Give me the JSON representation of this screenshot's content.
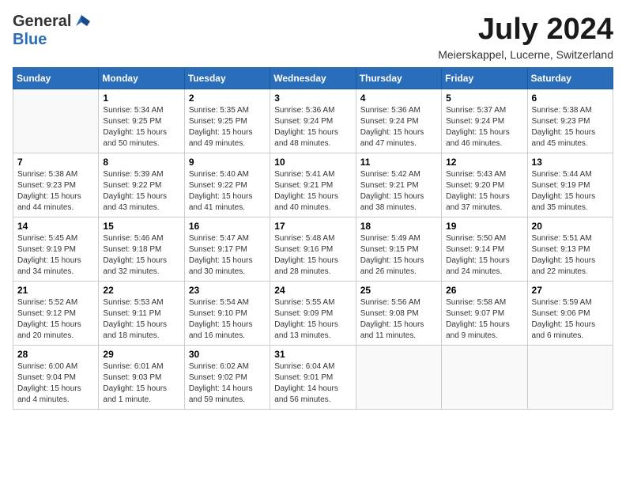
{
  "header": {
    "logo_general": "General",
    "logo_blue": "Blue",
    "month_title": "July 2024",
    "location": "Meierskappel, Lucerne, Switzerland"
  },
  "weekdays": [
    "Sunday",
    "Monday",
    "Tuesday",
    "Wednesday",
    "Thursday",
    "Friday",
    "Saturday"
  ],
  "weeks": [
    [
      {
        "day": "",
        "sunrise": "",
        "sunset": "",
        "daylight": ""
      },
      {
        "day": "1",
        "sunrise": "Sunrise: 5:34 AM",
        "sunset": "Sunset: 9:25 PM",
        "daylight": "Daylight: 15 hours and 50 minutes."
      },
      {
        "day": "2",
        "sunrise": "Sunrise: 5:35 AM",
        "sunset": "Sunset: 9:25 PM",
        "daylight": "Daylight: 15 hours and 49 minutes."
      },
      {
        "day": "3",
        "sunrise": "Sunrise: 5:36 AM",
        "sunset": "Sunset: 9:24 PM",
        "daylight": "Daylight: 15 hours and 48 minutes."
      },
      {
        "day": "4",
        "sunrise": "Sunrise: 5:36 AM",
        "sunset": "Sunset: 9:24 PM",
        "daylight": "Daylight: 15 hours and 47 minutes."
      },
      {
        "day": "5",
        "sunrise": "Sunrise: 5:37 AM",
        "sunset": "Sunset: 9:24 PM",
        "daylight": "Daylight: 15 hours and 46 minutes."
      },
      {
        "day": "6",
        "sunrise": "Sunrise: 5:38 AM",
        "sunset": "Sunset: 9:23 PM",
        "daylight": "Daylight: 15 hours and 45 minutes."
      }
    ],
    [
      {
        "day": "7",
        "sunrise": "Sunrise: 5:38 AM",
        "sunset": "Sunset: 9:23 PM",
        "daylight": "Daylight: 15 hours and 44 minutes."
      },
      {
        "day": "8",
        "sunrise": "Sunrise: 5:39 AM",
        "sunset": "Sunset: 9:22 PM",
        "daylight": "Daylight: 15 hours and 43 minutes."
      },
      {
        "day": "9",
        "sunrise": "Sunrise: 5:40 AM",
        "sunset": "Sunset: 9:22 PM",
        "daylight": "Daylight: 15 hours and 41 minutes."
      },
      {
        "day": "10",
        "sunrise": "Sunrise: 5:41 AM",
        "sunset": "Sunset: 9:21 PM",
        "daylight": "Daylight: 15 hours and 40 minutes."
      },
      {
        "day": "11",
        "sunrise": "Sunrise: 5:42 AM",
        "sunset": "Sunset: 9:21 PM",
        "daylight": "Daylight: 15 hours and 38 minutes."
      },
      {
        "day": "12",
        "sunrise": "Sunrise: 5:43 AM",
        "sunset": "Sunset: 9:20 PM",
        "daylight": "Daylight: 15 hours and 37 minutes."
      },
      {
        "day": "13",
        "sunrise": "Sunrise: 5:44 AM",
        "sunset": "Sunset: 9:19 PM",
        "daylight": "Daylight: 15 hours and 35 minutes."
      }
    ],
    [
      {
        "day": "14",
        "sunrise": "Sunrise: 5:45 AM",
        "sunset": "Sunset: 9:19 PM",
        "daylight": "Daylight: 15 hours and 34 minutes."
      },
      {
        "day": "15",
        "sunrise": "Sunrise: 5:46 AM",
        "sunset": "Sunset: 9:18 PM",
        "daylight": "Daylight: 15 hours and 32 minutes."
      },
      {
        "day": "16",
        "sunrise": "Sunrise: 5:47 AM",
        "sunset": "Sunset: 9:17 PM",
        "daylight": "Daylight: 15 hours and 30 minutes."
      },
      {
        "day": "17",
        "sunrise": "Sunrise: 5:48 AM",
        "sunset": "Sunset: 9:16 PM",
        "daylight": "Daylight: 15 hours and 28 minutes."
      },
      {
        "day": "18",
        "sunrise": "Sunrise: 5:49 AM",
        "sunset": "Sunset: 9:15 PM",
        "daylight": "Daylight: 15 hours and 26 minutes."
      },
      {
        "day": "19",
        "sunrise": "Sunrise: 5:50 AM",
        "sunset": "Sunset: 9:14 PM",
        "daylight": "Daylight: 15 hours and 24 minutes."
      },
      {
        "day": "20",
        "sunrise": "Sunrise: 5:51 AM",
        "sunset": "Sunset: 9:13 PM",
        "daylight": "Daylight: 15 hours and 22 minutes."
      }
    ],
    [
      {
        "day": "21",
        "sunrise": "Sunrise: 5:52 AM",
        "sunset": "Sunset: 9:12 PM",
        "daylight": "Daylight: 15 hours and 20 minutes."
      },
      {
        "day": "22",
        "sunrise": "Sunrise: 5:53 AM",
        "sunset": "Sunset: 9:11 PM",
        "daylight": "Daylight: 15 hours and 18 minutes."
      },
      {
        "day": "23",
        "sunrise": "Sunrise: 5:54 AM",
        "sunset": "Sunset: 9:10 PM",
        "daylight": "Daylight: 15 hours and 16 minutes."
      },
      {
        "day": "24",
        "sunrise": "Sunrise: 5:55 AM",
        "sunset": "Sunset: 9:09 PM",
        "daylight": "Daylight: 15 hours and 13 minutes."
      },
      {
        "day": "25",
        "sunrise": "Sunrise: 5:56 AM",
        "sunset": "Sunset: 9:08 PM",
        "daylight": "Daylight: 15 hours and 11 minutes."
      },
      {
        "day": "26",
        "sunrise": "Sunrise: 5:58 AM",
        "sunset": "Sunset: 9:07 PM",
        "daylight": "Daylight: 15 hours and 9 minutes."
      },
      {
        "day": "27",
        "sunrise": "Sunrise: 5:59 AM",
        "sunset": "Sunset: 9:06 PM",
        "daylight": "Daylight: 15 hours and 6 minutes."
      }
    ],
    [
      {
        "day": "28",
        "sunrise": "Sunrise: 6:00 AM",
        "sunset": "Sunset: 9:04 PM",
        "daylight": "Daylight: 15 hours and 4 minutes."
      },
      {
        "day": "29",
        "sunrise": "Sunrise: 6:01 AM",
        "sunset": "Sunset: 9:03 PM",
        "daylight": "Daylight: 15 hours and 1 minute."
      },
      {
        "day": "30",
        "sunrise": "Sunrise: 6:02 AM",
        "sunset": "Sunset: 9:02 PM",
        "daylight": "Daylight: 14 hours and 59 minutes."
      },
      {
        "day": "31",
        "sunrise": "Sunrise: 6:04 AM",
        "sunset": "Sunset: 9:01 PM",
        "daylight": "Daylight: 14 hours and 56 minutes."
      },
      {
        "day": "",
        "sunrise": "",
        "sunset": "",
        "daylight": ""
      },
      {
        "day": "",
        "sunrise": "",
        "sunset": "",
        "daylight": ""
      },
      {
        "day": "",
        "sunrise": "",
        "sunset": "",
        "daylight": ""
      }
    ]
  ]
}
